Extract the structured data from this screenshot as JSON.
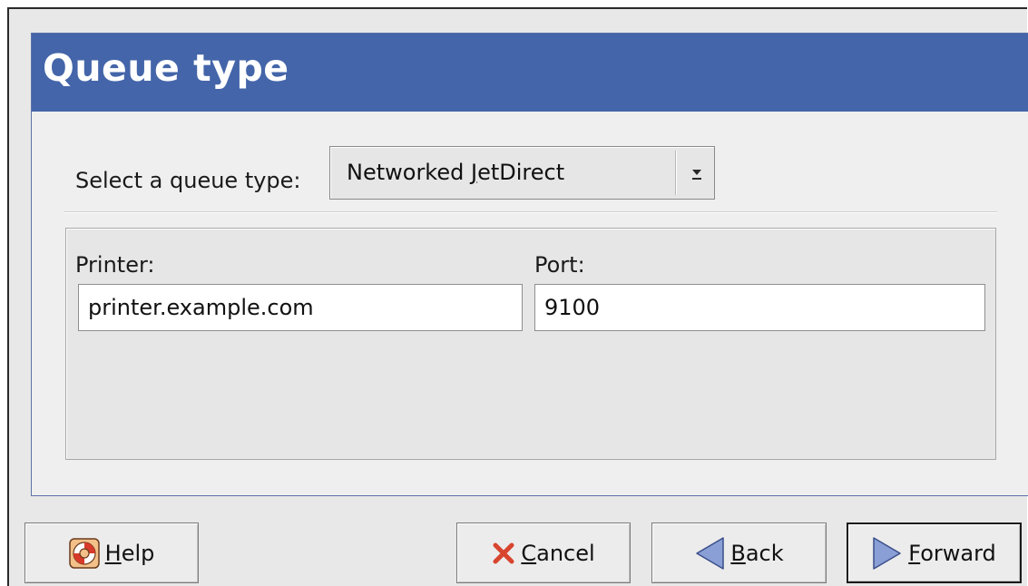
{
  "page": {
    "title": "Queue type"
  },
  "queue_type": {
    "label": "Select a queue type:",
    "selected_prefix": "Networked ",
    "selected_mnemonic": "J",
    "selected_rest": "etDirect"
  },
  "fields": {
    "printer": {
      "label": "Printer:",
      "value": "printer.example.com"
    },
    "port": {
      "label": "Port:",
      "value": "9100"
    }
  },
  "buttons": {
    "help": {
      "mnemonic": "H",
      "rest": "elp",
      "icon": "lifebuoy-icon"
    },
    "cancel": {
      "mnemonic": "C",
      "rest": "ancel",
      "icon": "red-x-icon"
    },
    "back": {
      "mnemonic": "B",
      "rest": "ack",
      "icon": "left-arrow-icon"
    },
    "forward": {
      "mnemonic": "F",
      "rest": "orward",
      "icon": "right-arrow-icon"
    }
  },
  "colors": {
    "banner": "#4465a9",
    "banner_text": "#ffffff",
    "cancel_icon": "#d8452e",
    "arrow_icon": "#8a9fd6"
  }
}
